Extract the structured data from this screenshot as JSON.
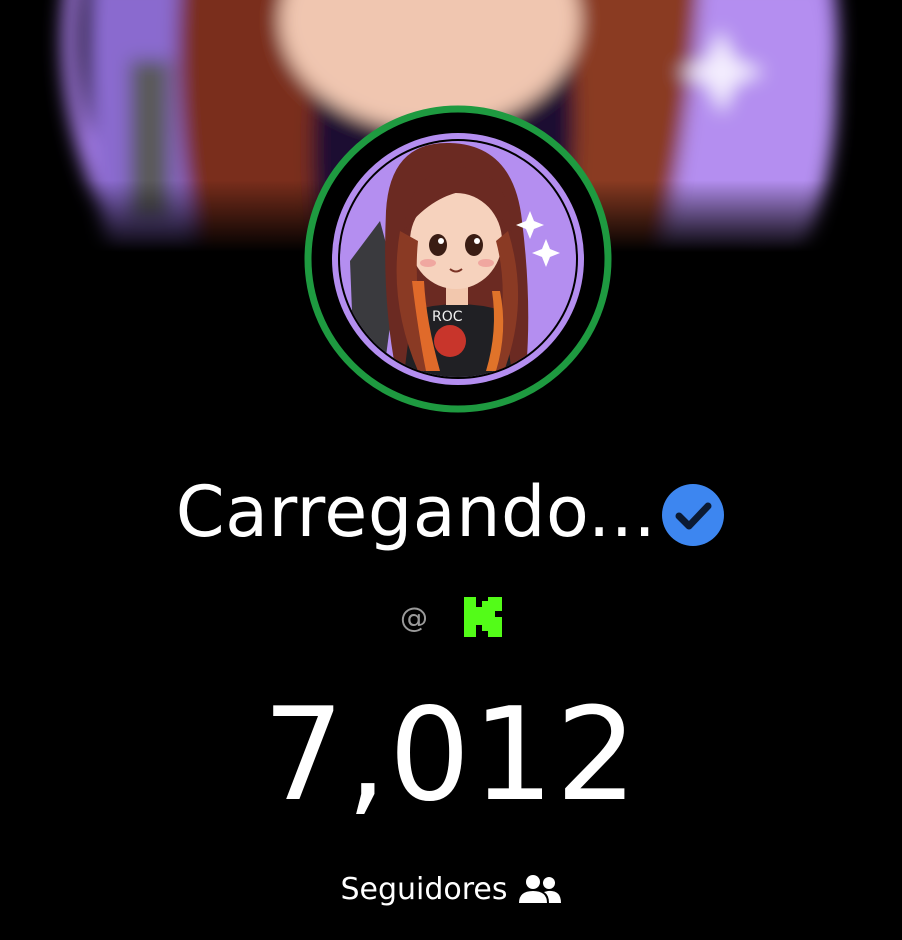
{
  "profile": {
    "display_name": "Carregando...",
    "verified_icon": "verified-check-icon",
    "handle_prefix": "@",
    "platform_icon": "kick-logo-icon",
    "follower_count": "7,012",
    "followers_label": "Seguidores",
    "followers_icon": "users-icon"
  },
  "colors": {
    "background": "#000000",
    "avatar_ring": "#1e9a40",
    "avatar_bg": "#b48ef0",
    "verified": "#3d86f0",
    "kick_green": "#53fc18",
    "handle_gray": "#9a9a9a"
  }
}
